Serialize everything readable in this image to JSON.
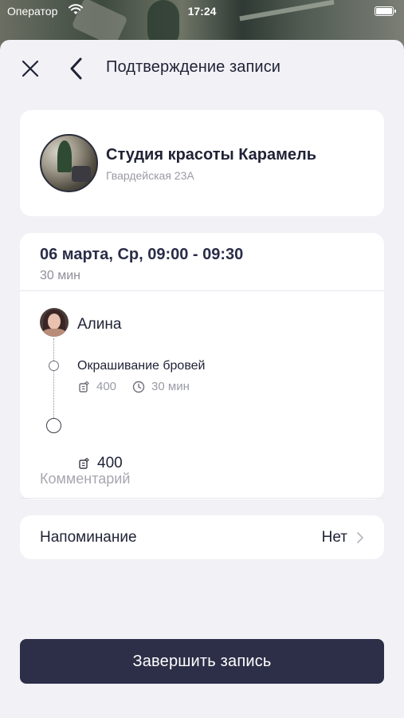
{
  "status_bar": {
    "carrier": "Оператор",
    "time": "17:24"
  },
  "header": {
    "title": "Подтверждение записи",
    "close_icon": "close-icon",
    "back_icon": "chevron-left-icon"
  },
  "salon": {
    "name": "Студия красоты Карамель",
    "address": "Гвардейская 23А"
  },
  "booking": {
    "date_time": "06 марта, Ср, 09:00 - 09:30",
    "duration": "30 мин",
    "master_name": "Алина",
    "services": [
      {
        "name": "Окрашивание бровей",
        "price": "400",
        "duration": "30 мин"
      }
    ],
    "total": "400",
    "comment_placeholder": "Комментарий"
  },
  "reminder": {
    "label": "Напоминание",
    "value": "Нет"
  },
  "footer": {
    "finish_label": "Завершить запись"
  },
  "colors": {
    "accent": "#2d2f48",
    "background": "#f1f1f6",
    "card": "#ffffff",
    "muted_text": "#9a9ba5"
  }
}
